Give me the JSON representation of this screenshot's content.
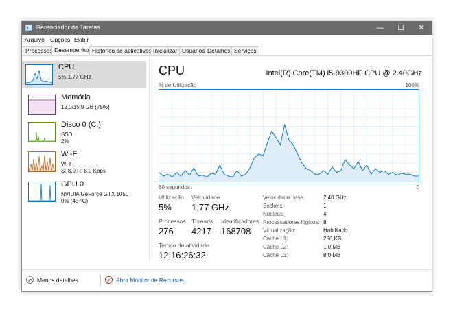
{
  "window": {
    "title": "Gerenciador de Tarefas",
    "controls": [
      "—",
      "☐",
      "✕"
    ]
  },
  "menu": [
    "Arquivo",
    "Opções",
    "Exibir"
  ],
  "tabs": [
    "Processos",
    "Desempenho",
    "Histórico de aplicativos",
    "Inicializar",
    "Usuários",
    "Detalhes",
    "Serviços"
  ],
  "sidebar": {
    "items": [
      {
        "name": "CPU",
        "lines": [
          "5%  1,77 GHz"
        ],
        "icon": "cpu-graph-icon",
        "color": "#1178c7"
      },
      {
        "name": "Memória",
        "lines": [
          "12,0/15,9 GB (75%)"
        ],
        "icon": "memory-graph-icon",
        "color": "#8b2f8f"
      },
      {
        "name": "Disco 0 (C:)",
        "lines": [
          "SSD",
          "2%"
        ],
        "icon": "disk-graph-icon",
        "color": "#4d9a06"
      },
      {
        "name": "Wi-Fi",
        "lines": [
          "Wi-Fi",
          "S: 8,0  R: 8,0 Kbps"
        ],
        "icon": "wifi-graph-icon",
        "color": "#b5651d"
      },
      {
        "name": "GPU 0",
        "lines": [
          "NVIDIA GeForce GTX 1050",
          "0% (45 °C)"
        ],
        "icon": "gpu-graph-icon",
        "color": "#1178c7"
      }
    ]
  },
  "main": {
    "title": "CPU",
    "model": "Intel(R) Core(TM) i5-9300HF CPU @ 2.40GHz",
    "graph_label_left": "% de Utilização",
    "graph_label_right": "100%",
    "axis_left": "60 segundos",
    "axis_right": "0",
    "stats": {
      "utilization_label": "Utilização",
      "utilization": "5%",
      "speed_label": "Velocidade",
      "speed": "1,77 GHz",
      "processes_label": "Processos",
      "processes": "276",
      "threads_label": "Threads",
      "threads": "4217",
      "handles_label": "Identificadores",
      "handles": "168708",
      "uptime_label": "Tempo de atividade",
      "uptime": "12:16:26:32"
    },
    "specs": [
      {
        "label": "Velocidade base:",
        "value": "2,40 GHz"
      },
      {
        "label": "Sockets:",
        "value": "1"
      },
      {
        "label": "Núcleos:",
        "value": "4"
      },
      {
        "label": "Processadores lógicos:",
        "value": "8"
      },
      {
        "label": "Virtualização:",
        "value": "Habilitado"
      },
      {
        "label": "Cache L1:",
        "value": "256 KB"
      },
      {
        "label": "Cache L2:",
        "value": "1,0 MB"
      },
      {
        "label": "Cache L3:",
        "value": "8,0 MB"
      }
    ]
  },
  "footer": {
    "less_details": "Menos detalhes",
    "resource_monitor": "Abrir Monitor de Recursos",
    "link_color": "#1a5fb4"
  },
  "chart_data": {
    "type": "area",
    "xlabel": "60 segundos",
    "ylabel": "% de Utilização",
    "ylim": [
      0,
      100
    ],
    "x": [
      60,
      59,
      58,
      57,
      56,
      55,
      54,
      53,
      52,
      51,
      50,
      49,
      48,
      47,
      46,
      45,
      44,
      43,
      42,
      41,
      40,
      39,
      38,
      37,
      36,
      35,
      34,
      33,
      32,
      31,
      30,
      29,
      28,
      27,
      26,
      25,
      24,
      23,
      22,
      21,
      20,
      19,
      18,
      17,
      16,
      15,
      14,
      13,
      12,
      11,
      10,
      9,
      8,
      7,
      6,
      5,
      4,
      3,
      2,
      1,
      0
    ],
    "values": [
      10,
      6,
      8,
      5,
      10,
      6,
      12,
      7,
      15,
      6,
      7,
      5,
      9,
      8,
      18,
      8,
      6,
      5,
      12,
      6,
      8,
      15,
      26,
      30,
      28,
      42,
      55,
      48,
      40,
      62,
      45,
      40,
      30,
      20,
      14,
      12,
      8,
      8,
      12,
      8,
      16,
      10,
      12,
      24,
      18,
      14,
      22,
      12,
      18,
      8,
      14,
      10,
      12,
      8,
      10,
      7,
      9,
      8,
      8,
      6,
      6
    ],
    "grid": true
  }
}
